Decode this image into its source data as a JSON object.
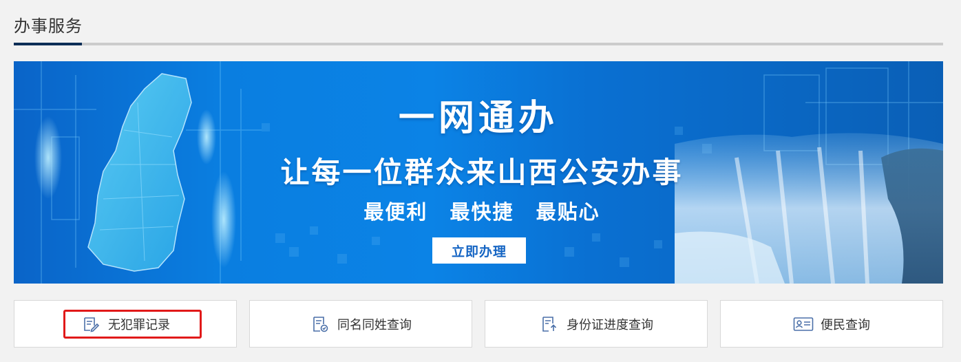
{
  "section": {
    "title": "办事服务"
  },
  "banner": {
    "title": "一网通办",
    "subtitle": "让每一位群众来山西公安办事",
    "tagline": "最便利  最快捷  最贴心",
    "button_label": "立即办理"
  },
  "services": [
    {
      "label": "无犯罪记录",
      "icon": "document-edit-icon",
      "highlighted": true
    },
    {
      "label": "同名同姓查询",
      "icon": "document-check-icon",
      "highlighted": false
    },
    {
      "label": "身份证进度查询",
      "icon": "document-upload-icon",
      "highlighted": false
    },
    {
      "label": "便民查询",
      "icon": "id-card-icon",
      "highlighted": false
    }
  ],
  "colors": {
    "accent": "#0d2e57",
    "icon": "#4a6fa8",
    "highlight": "#e11919",
    "button_text": "#1464c3"
  }
}
